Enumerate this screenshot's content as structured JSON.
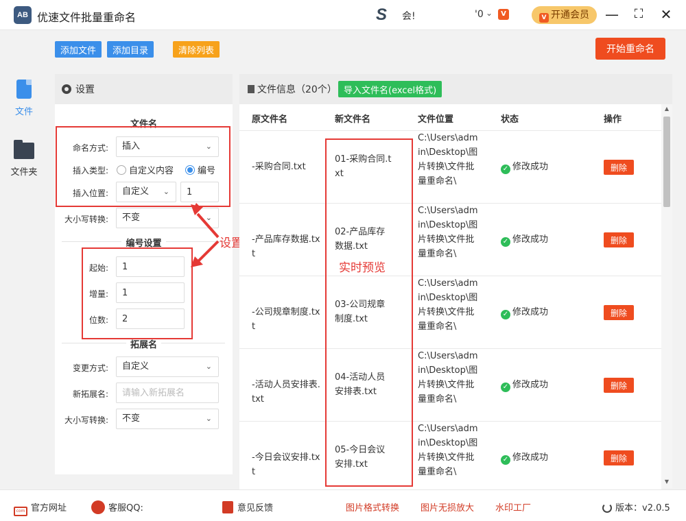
{
  "app": {
    "title": "优速文件批量重命名",
    "logo_text": "AB"
  },
  "titlebar": {
    "user_name": "会!",
    "msg_count": "'0",
    "vip_label": "开通会员"
  },
  "leftnav": {
    "items": [
      {
        "label": "文件",
        "icon": "file-icon"
      },
      {
        "label": "文件夹",
        "icon": "folder-icon"
      }
    ]
  },
  "toolbar": {
    "add_file": "添加文件",
    "add_dir": "添加目录",
    "clear_list": "清除列表",
    "start_rename": "开始重命名"
  },
  "settings": {
    "header": "设置",
    "filename_section": "文件名",
    "naming_mode_label": "命名方式:",
    "naming_mode_value": "插入",
    "insert_type_label": "插入类型:",
    "insert_type_options": [
      "自定义内容",
      "编号"
    ],
    "insert_type_selected": "编号",
    "insert_pos_label": "插入位置:",
    "insert_pos_value": "自定义",
    "insert_pos_index": "1",
    "case_label": "大小写转换:",
    "case_value": "不变",
    "numbering_section": "编号设置",
    "start_label": "起始:",
    "start_value": "1",
    "step_label": "增量:",
    "step_value": "1",
    "digits_label": "位数:",
    "digits_value": "2",
    "ext_section": "拓展名",
    "ext_mode_label": "变更方式:",
    "ext_mode_value": "自定义",
    "new_ext_label": "新拓展名:",
    "new_ext_placeholder": "请输入新拓展名",
    "ext_case_label": "大小写转换:",
    "ext_case_value": "不变"
  },
  "annotations": {
    "settings": "设置",
    "preview": "实时预览"
  },
  "files": {
    "header": "文件信息（20个）",
    "import_button": "导入文件名(excel格式)",
    "columns": {
      "original": "原文件名",
      "new": "新文件名",
      "location": "文件位置",
      "status": "状态",
      "action": "操作"
    },
    "rows": [
      {
        "original": "-采购合同.txt",
        "new": "01-采购合同.txt",
        "location": "C:\\Users\\admin\\Desktop\\图片转换\\文件批量重命名\\",
        "status": "修改成功",
        "action": "删除"
      },
      {
        "original": "-产品库存数据.txt",
        "new": "02-产品库存数据.txt",
        "location": "C:\\Users\\admin\\Desktop\\图片转换\\文件批量重命名\\",
        "status": "修改成功",
        "action": "删除"
      },
      {
        "original": "-公司规章制度.txt",
        "new": "03-公司规章制度.txt",
        "location": "C:\\Users\\admin\\Desktop\\图片转换\\文件批量重命名\\",
        "status": "修改成功",
        "action": "删除"
      },
      {
        "original": "-活动人员安排表.txt",
        "new": "04-活动人员安排表.txt",
        "location": "C:\\Users\\admin\\Desktop\\图片转换\\文件批量重命名\\",
        "status": "修改成功",
        "action": "删除"
      },
      {
        "original": "-今日会议安排.txt",
        "new": "05-今日会议安排.txt",
        "location": "C:\\Users\\admin\\Desktop\\图片转换\\文件批量重命名\\",
        "status": "修改成功",
        "action": "删除"
      }
    ]
  },
  "footer": {
    "website": "官方网址",
    "qq": "客服QQ:",
    "feedback": "意见反馈",
    "image_convert": "图片格式转换",
    "image_enlarge": "图片无损放大",
    "watermark": "水印工厂",
    "version": "版本：v2.0.5"
  },
  "colors": {
    "primary_blue": "#3b8fea",
    "orange_red": "#ef4c1f",
    "green": "#2ebd59",
    "annotation_red": "#e53935",
    "vip_gold": "#f7c76a"
  }
}
